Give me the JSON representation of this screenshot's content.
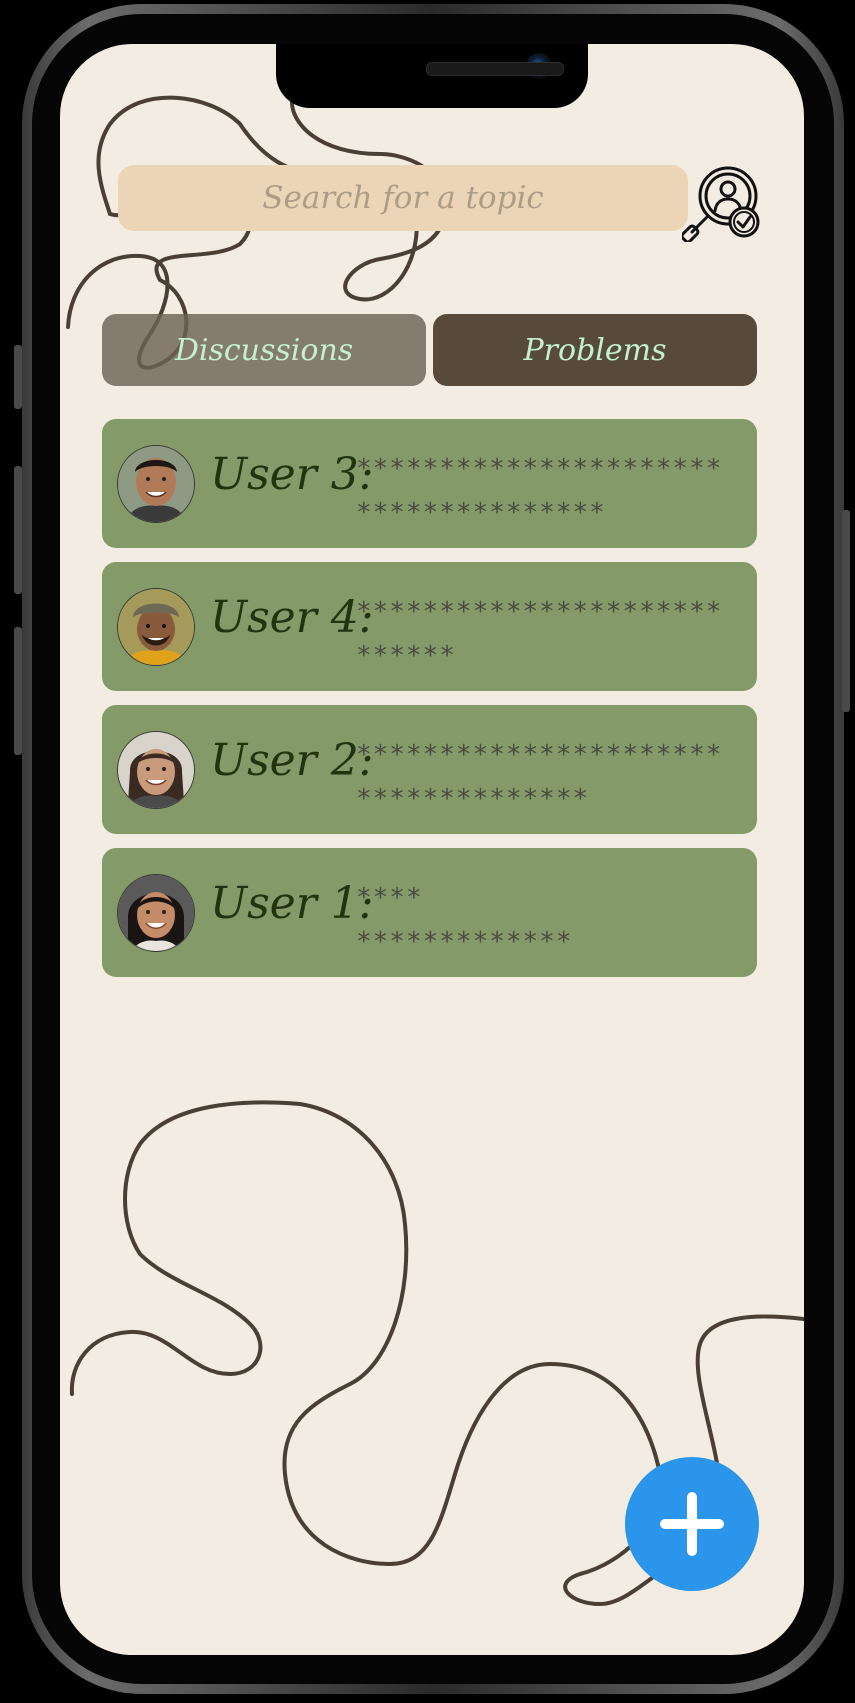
{
  "search": {
    "placeholder": "Search for a topic",
    "icon": "profile-search-icon"
  },
  "tabs": [
    {
      "label": "Discussions",
      "active": false
    },
    {
      "label": "Problems",
      "active": true
    }
  ],
  "posts": [
    {
      "user": "User 3:",
      "text": "**********************\n***************",
      "avatar": "avatar-user-3"
    },
    {
      "user": "User 4:",
      "text": "**********************\n******",
      "avatar": "avatar-user-4"
    },
    {
      "user": "User 2:",
      "text": "**********************\n**************",
      "avatar": "avatar-user-2"
    },
    {
      "user": "User 1:",
      "text": "****\n*************",
      "avatar": "avatar-user-1"
    }
  ],
  "fab": {
    "icon": "plus-icon"
  },
  "colors": {
    "background": "#f2ece3",
    "search_field": "#ecd5b7",
    "tab_inactive": "#7a6e60",
    "tab_active": "#574a3a",
    "tab_text": "#c3f0d0",
    "card": "#849b69",
    "user_text": "#22330f",
    "fab": "#2a95ea"
  }
}
